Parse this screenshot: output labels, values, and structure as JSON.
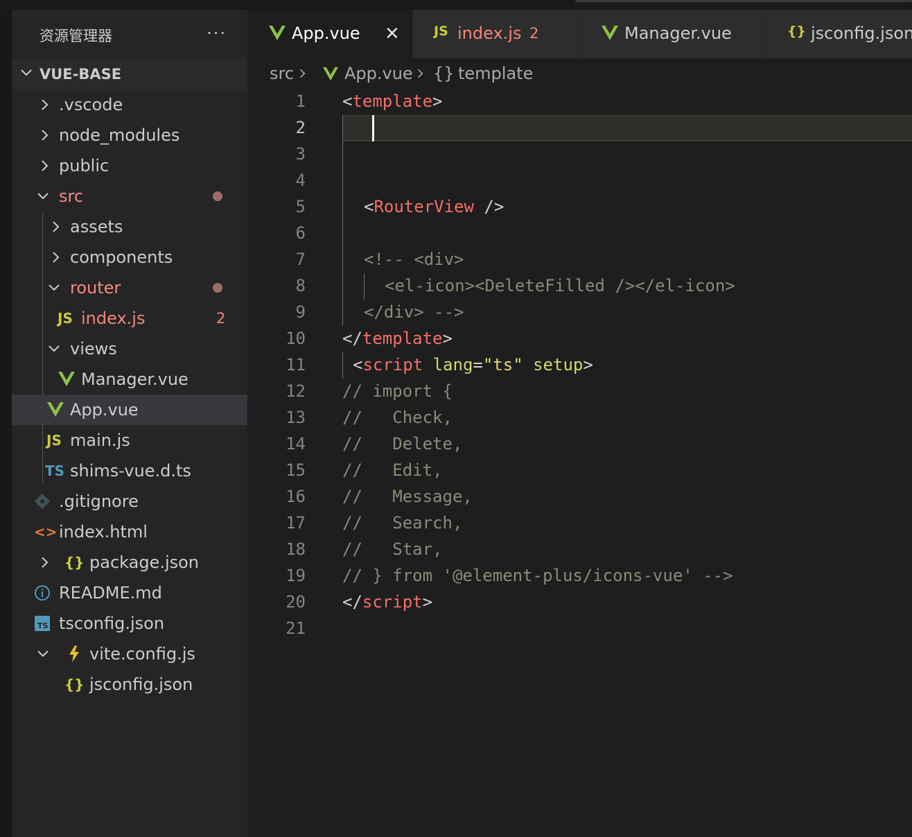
{
  "sidebar": {
    "title": "资源管理器",
    "more": "···",
    "root": "VUE-BASE",
    "items": [
      {
        "label": ".vscode",
        "kind": "folder-collapsed"
      },
      {
        "label": "node_modules",
        "kind": "folder-collapsed"
      },
      {
        "label": "public",
        "kind": "folder-collapsed"
      },
      {
        "label": "src",
        "kind": "folder-open",
        "modified": true
      },
      {
        "label": "assets",
        "kind": "folder-collapsed"
      },
      {
        "label": "components",
        "kind": "folder-collapsed"
      },
      {
        "label": "router",
        "kind": "folder-open",
        "modified": true
      },
      {
        "label": "index.js",
        "kind": "js",
        "problems": "2"
      },
      {
        "label": "views",
        "kind": "folder-open"
      },
      {
        "label": "Manager.vue",
        "kind": "vue"
      },
      {
        "label": "App.vue",
        "kind": "vue",
        "selected": true
      },
      {
        "label": "main.js",
        "kind": "js"
      },
      {
        "label": "shims-vue.d.ts",
        "kind": "ts"
      },
      {
        "label": ".gitignore",
        "kind": "git"
      },
      {
        "label": "index.html",
        "kind": "html"
      },
      {
        "label": "package.json",
        "kind": "json"
      },
      {
        "label": "README.md",
        "kind": "info"
      },
      {
        "label": "tsconfig.json",
        "kind": "tsconfig"
      },
      {
        "label": "vite.config.js",
        "kind": "vite"
      },
      {
        "label": "jsconfig.json",
        "kind": "json"
      }
    ]
  },
  "tabs": [
    {
      "label": "App.vue",
      "icon": "vue-icon",
      "active": true,
      "close": "✕"
    },
    {
      "label": "index.js",
      "icon": "js-icon",
      "count": "2"
    },
    {
      "label": "Manager.vue",
      "icon": "vue-icon"
    },
    {
      "label": "jsconfig.json",
      "icon": "json-icon"
    }
  ],
  "icons": {
    "js": "JS",
    "ts": "TS",
    "json": "{}",
    "html": "<>",
    "vue": "V"
  },
  "breadcrumb": {
    "folder": "src",
    "file": "App.vue",
    "symbol": "template"
  },
  "editor": {
    "line_numbers": [
      "1",
      "2",
      "3",
      "4",
      "5",
      "6",
      "7",
      "8",
      "9",
      "10",
      "11",
      "12",
      "13",
      "14",
      "15",
      "16",
      "17",
      "18",
      "19",
      "20",
      "21"
    ],
    "active_line": "2",
    "lines": {
      "l1_open": "<",
      "l1_tag": "template",
      "l1_close": ">",
      "l5_open": "<",
      "l5_tag": "RouterView",
      "l5_close": " />",
      "l7": "<!-- <div>",
      "l8": "<el-icon><DeleteFilled /></el-icon>",
      "l9": "</div> -->",
      "l10_open": "</",
      "l10_tag": "template",
      "l10_close": ">",
      "l11_open": "<",
      "l11_tag": "script",
      "l11_sp1": " ",
      "l11_attr": "lang",
      "l11_eq": "=",
      "l11_str": "\"ts\"",
      "l11_sp2": " ",
      "l11_attr2": "setup",
      "l11_close": ">",
      "l12": "// import {",
      "l13": "//   Check,",
      "l14": "//   Delete,",
      "l15": "//   Edit,",
      "l16": "//   Message,",
      "l17": "//   Search,",
      "l18": "//   Star,",
      "l19": "// } from '@element-plus/icons-vue' -->",
      "l20_open": "</",
      "l20_tag": "script",
      "l20_close": ">"
    }
  },
  "colors": {
    "vue_green": "#41b883",
    "js_yellow": "#cbcb41",
    "ts_blue": "#519aba",
    "modified": "#f38778"
  }
}
